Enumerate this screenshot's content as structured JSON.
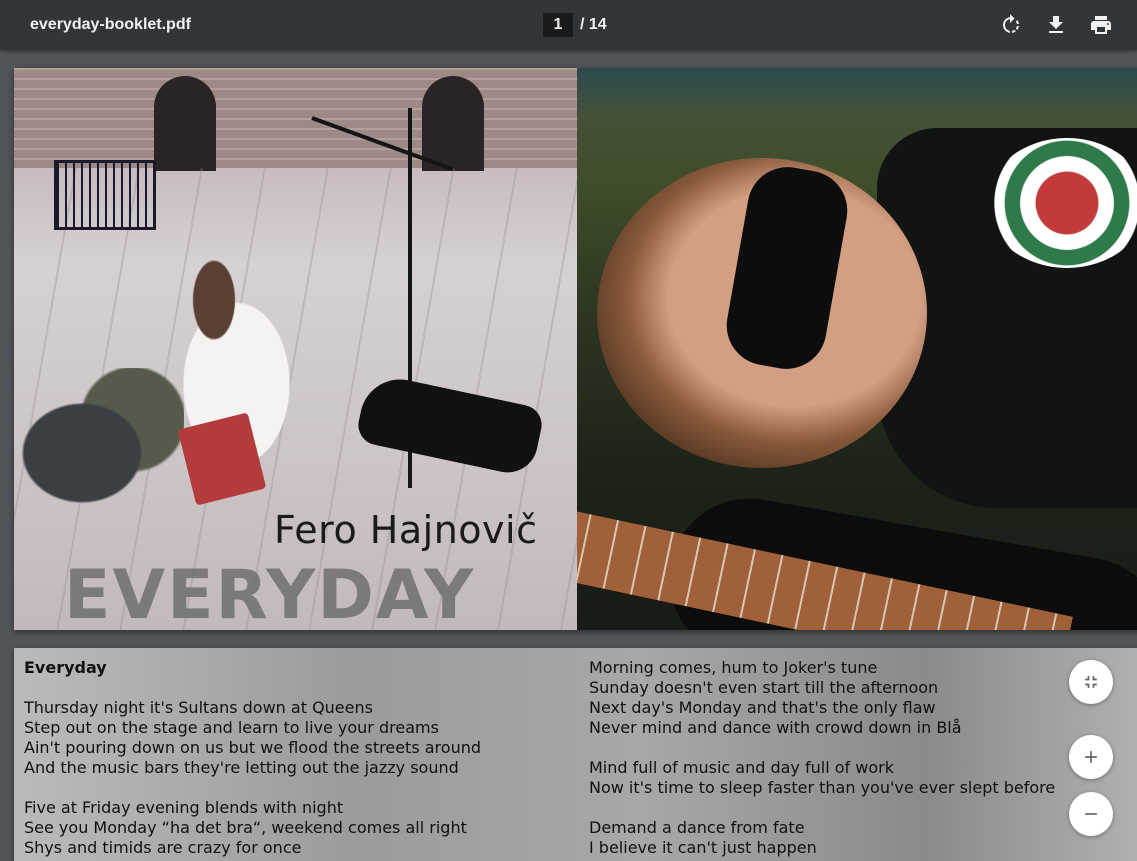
{
  "toolbar": {
    "file_name": "everyday-booklet.pdf",
    "current_page": "1",
    "page_total": "/ 14",
    "rotate_icon": "rotate-clockwise-icon",
    "download_icon": "download-icon",
    "print_icon": "print-icon"
  },
  "cover": {
    "artist": "Fero Hajnovič",
    "album": "EVERYDAY"
  },
  "lyrics": {
    "title": "Everyday",
    "left_stanzas": [
      [
        "Thursday night it's Sultans down at Queens",
        "Step out on the stage and learn to live your dreams",
        "Ain't pouring down on us but we flood the streets around",
        "And the music bars they're letting out the jazzy sound"
      ],
      [
        "Five at Friday evening blends with night",
        "See you Monday “ha det bra“, weekend comes all right",
        "Shys and timids are crazy for once"
      ]
    ],
    "right_stanzas": [
      [
        "Morning comes, hum to Joker's tune",
        "Sunday doesn't even start till the afternoon",
        "Next day's Monday and that's the only flaw",
        "Never mind and dance with crowd down in Blå"
      ],
      [
        "Mind full of music and day full of work",
        "Now it's time to sleep faster than you've ever slept before"
      ],
      [
        "Demand a dance from fate",
        "I believe it can't just happen"
      ]
    ]
  },
  "controls": {
    "fit_icon": "fit-to-page-icon",
    "zoom_in_icon": "zoom-in-icon",
    "zoom_out_icon": "zoom-out-icon"
  }
}
